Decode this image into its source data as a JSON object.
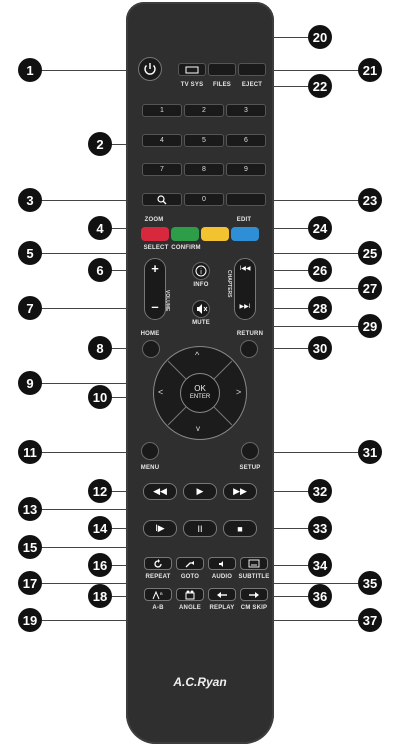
{
  "labels": {
    "tvsys": "TV SYS",
    "files": "FILES",
    "eject": "EJECT",
    "zoom": "ZOOM",
    "edit": "EDIT",
    "select": "SELECT",
    "confirm": "CONFIRM",
    "info": "INFO",
    "volume": "VOLUME",
    "chapters": "CHAPTERS",
    "mute": "MUTE",
    "home": "HOME",
    "return": "RETURN",
    "ok": "OK",
    "enter": "ENTER",
    "menu": "MENU",
    "setup": "SETUP",
    "repeat": "REPEAT",
    "goto": "GOTO",
    "audio": "AUDIO",
    "subtitle": "SUBTITLE",
    "ab": "A-B",
    "angle": "ANGLE",
    "replay": "REPLAY",
    "cmskip": "CM SKIP",
    "brand": "A.C.Ryan"
  },
  "numpad": [
    "1",
    "2",
    "3",
    "4",
    "5",
    "6",
    "7",
    "8",
    "9",
    "0"
  ],
  "symbols": {
    "vol_plus": "+",
    "vol_minus": "–",
    "rew": "◀◀",
    "play": "▶",
    "ff": "▶▶",
    "step": "I▶",
    "pause": "II",
    "stop": "■",
    "prev": "I◀◀",
    "next": "▶▶I",
    "up": "^",
    "down": "v",
    "left": "<",
    "right": ">"
  },
  "colors": {
    "red": "#d8283d",
    "green": "#2e9d48",
    "yellow": "#f2c230",
    "blue": "#2f8fd6"
  },
  "callouts": [
    "1",
    "2",
    "3",
    "4",
    "5",
    "6",
    "7",
    "8",
    "9",
    "10",
    "11",
    "12",
    "13",
    "14",
    "15",
    "16",
    "17",
    "18",
    "19",
    "20",
    "21",
    "22",
    "23",
    "24",
    "25",
    "26",
    "27",
    "28",
    "29",
    "30",
    "31",
    "32",
    "33",
    "34",
    "35",
    "36",
    "37"
  ]
}
